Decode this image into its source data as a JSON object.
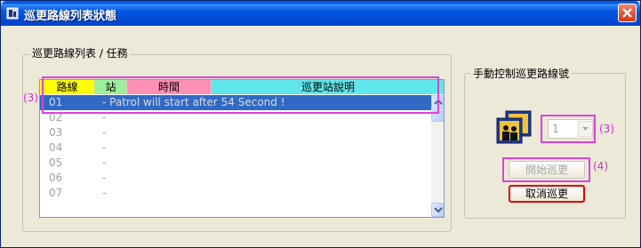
{
  "window": {
    "title": "巡更路線列表狀態"
  },
  "group_list": {
    "legend": "巡更路線列表 / 任務"
  },
  "listview": {
    "columns": [
      {
        "label": "路線",
        "color": "#ffff00"
      },
      {
        "label": "站",
        "color": "#9cf09c"
      },
      {
        "label": "時間",
        "color": "#ff8fb3"
      },
      {
        "label": "巡更站說明",
        "color": "#5fe6ea"
      }
    ],
    "rows": [
      {
        "num": "01",
        "message": "- Patrol will start after 54 Second !",
        "selected": true
      },
      {
        "num": "02",
        "message": "-"
      },
      {
        "num": "03",
        "message": "-"
      },
      {
        "num": "04",
        "message": "-"
      },
      {
        "num": "05",
        "message": "-"
      },
      {
        "num": "06",
        "message": "-"
      },
      {
        "num": "07",
        "message": "-"
      }
    ]
  },
  "group_manual": {
    "legend": "手動控制巡更路線號"
  },
  "route_select": {
    "value": "1"
  },
  "buttons": {
    "start_patrol": "開始巡更",
    "cancel_patrol": "取消巡更"
  },
  "annotations": {
    "row_label": "(3)",
    "combo_label": "(3)",
    "start_label": "(4)"
  },
  "colors": {
    "highlight": "#e040e0",
    "selection": "#316ac5",
    "titlebar": "#0058e6"
  }
}
